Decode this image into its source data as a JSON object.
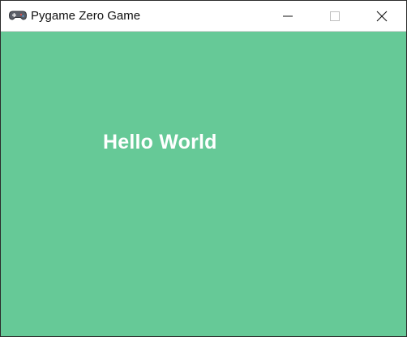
{
  "window": {
    "title": "Pygame Zero Game",
    "icon": "gamepad-icon"
  },
  "controls": {
    "minimize_icon": "minimize-icon",
    "maximize_icon": "maximize-icon",
    "close_icon": "close-icon"
  },
  "game": {
    "background_color": "#66c997",
    "text": "Hello World",
    "text_color": "#ffffff"
  }
}
